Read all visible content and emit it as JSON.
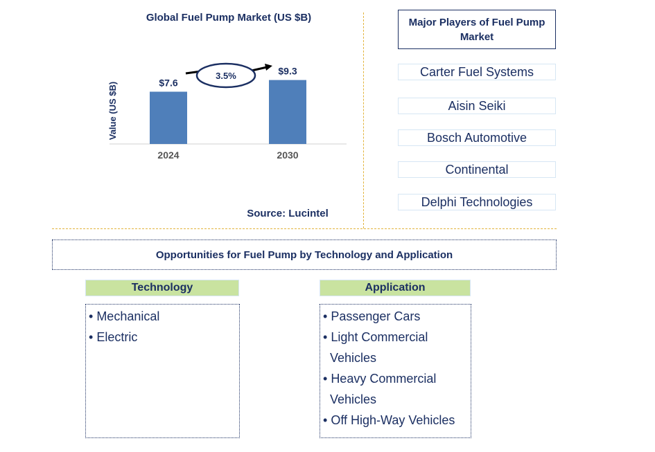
{
  "chart": {
    "title": "Global Fuel Pump Market (US $B)",
    "source": "Source: Lucintel",
    "cagr_label": "3.5%"
  },
  "chart_data": {
    "type": "bar",
    "title": "Global Fuel Pump Market (US $B)",
    "categories": [
      "2024",
      "2030"
    ],
    "values": [
      7.6,
      9.3
    ],
    "data_labels": [
      "$7.6",
      "$9.3"
    ],
    "xlabel": "",
    "ylabel": "Value (US $B)",
    "ylim": [
      0,
      10
    ],
    "grid": false,
    "annotation": "3.5%",
    "bar_color": "#4f7fba"
  },
  "players": {
    "title": "Major Players of Fuel Pump Market",
    "items": [
      "Carter Fuel Systems",
      "Aisin Seiki",
      "Bosch Automotive",
      "Continental",
      "Delphi Technologies"
    ]
  },
  "opportunities": {
    "title": "Opportunities for Fuel Pump by Technology and Application",
    "technology": {
      "heading": "Technology",
      "items": [
        "Mechanical",
        "Electric"
      ]
    },
    "application": {
      "heading": "Application",
      "items": [
        {
          "line1": "Passenger Cars",
          "line2": ""
        },
        {
          "line1": "Light Commercial",
          "line2": "Vehicles"
        },
        {
          "line1": "Heavy Commercial",
          "line2": "Vehicles"
        },
        {
          "line1": "Off High-Way Vehicles",
          "line2": ""
        }
      ]
    }
  },
  "colors": {
    "text": "#1b2f62",
    "bar": "#4f7fba",
    "header_fill": "#c9e3a0",
    "divider": "#e2b33a"
  }
}
